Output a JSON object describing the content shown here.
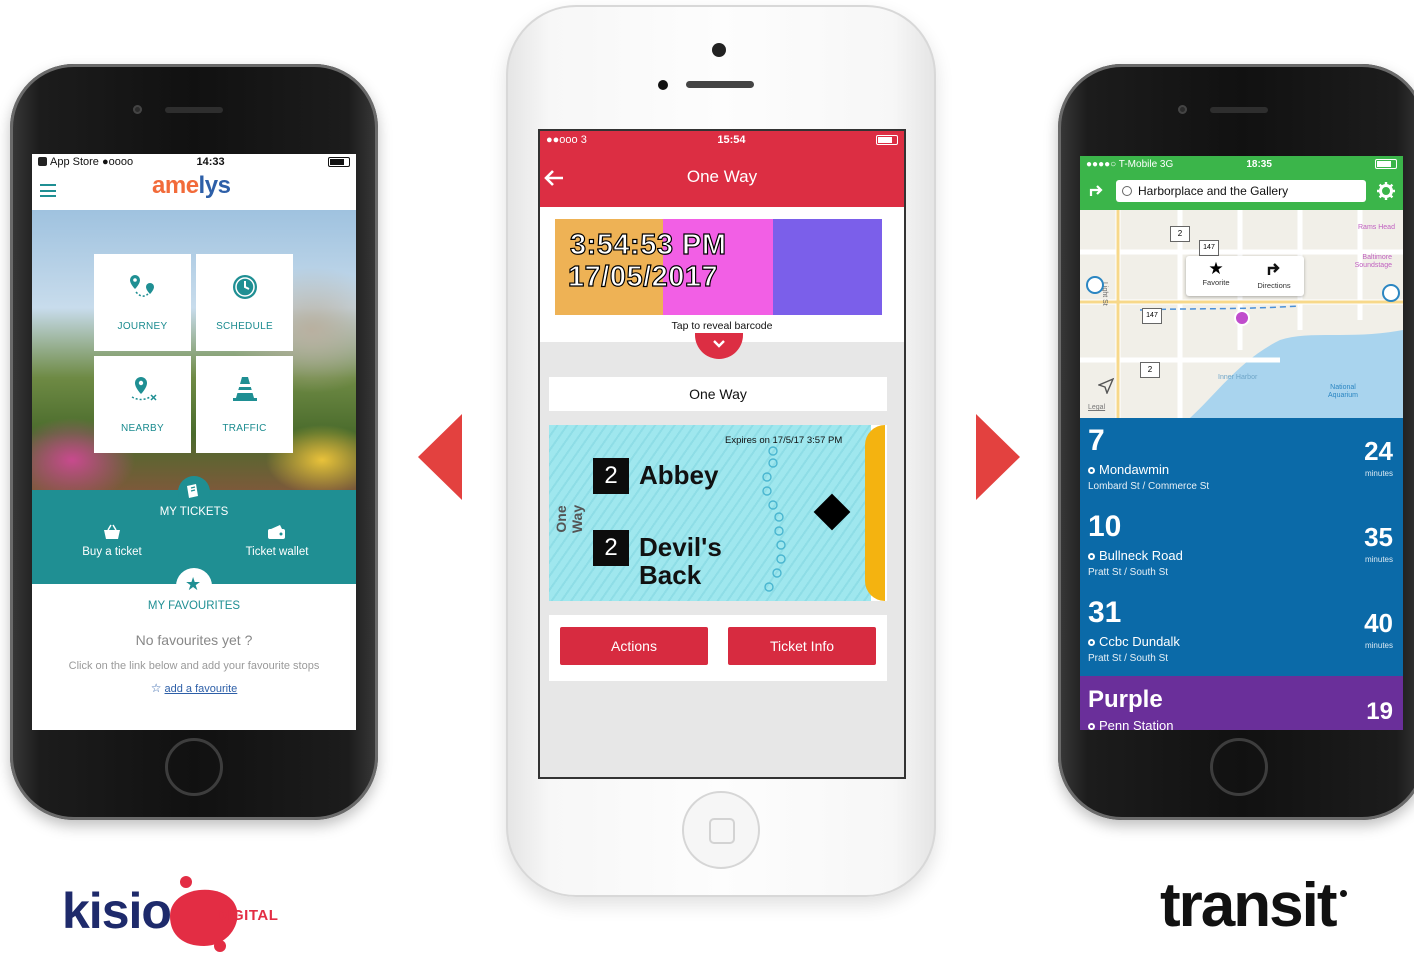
{
  "phone_amelys": {
    "status": {
      "carrier": "App Store",
      "signal": "●oooo",
      "time": "14:33"
    },
    "logo": {
      "pre": "ame",
      "accent": "l",
      "post": "ys"
    },
    "tiles": [
      {
        "label": "JOURNEY",
        "icon": "journey-icon"
      },
      {
        "label": "SCHEDULE",
        "icon": "clock-icon"
      },
      {
        "label": "NEARBY",
        "icon": "nearby-pin-icon"
      },
      {
        "label": "TRAFFIC",
        "icon": "traffic-cone-icon"
      }
    ],
    "my_tickets": {
      "title": "MY TICKETS",
      "buy": "Buy a ticket",
      "wallet": "Ticket wallet"
    },
    "favourites": {
      "title": "MY FAVOURITES",
      "empty": "No favourites yet ?",
      "hint": "Click on the link below and add your favourite stops",
      "link": "add a favourite"
    },
    "colors": {
      "teal": "#1f8f93",
      "brand_orange": "#f26b3a",
      "brand_blue": "#2d5fa8"
    }
  },
  "phone_ticket": {
    "status": {
      "signal": "●●ooo 3",
      "time": "15:54"
    },
    "header_title": "One Way",
    "banner": {
      "time": "3:54:53 PM",
      "date": "17/05/2017",
      "hint": "Tap to reveal barcode"
    },
    "ticket_type": "One Way",
    "ticket": {
      "side_label": "One Way",
      "expires": "Expires on 17/5/17 3:57 PM",
      "from": {
        "zone": "2",
        "name_l1": "Abbey",
        "name_l2": ""
      },
      "to": {
        "zone": "2",
        "name_l1": "Devil's",
        "name_l2": "Back"
      }
    },
    "buttons": {
      "actions": "Actions",
      "info": "Ticket Info"
    },
    "colors": {
      "red": "#dc2e43",
      "band_orange": "#eeb255",
      "band_pink": "#f25fe5",
      "band_purple": "#7b5fea"
    }
  },
  "phone_transit": {
    "status": {
      "carrier": "●●●●○ T-Mobile  3G",
      "time": "18:35"
    },
    "search": {
      "value": "Harborplace and the Gallery"
    },
    "map": {
      "labels": {
        "rams_head": "Rams Head",
        "baltimore_soundstage": "Baltimore Soundstage",
        "inner_harbor": "Inner Harbor",
        "national_aquarium": "National Aquarium",
        "light_st": "Light St",
        "legal": "Legal"
      },
      "route_shields": [
        "2",
        "147",
        "147",
        "2"
      ],
      "popup": {
        "favorite": "Favorite",
        "directions": "Directions"
      }
    },
    "routes": [
      {
        "number": "7",
        "destination": "Mondawmin",
        "stop": "Lombard St / Commerce St",
        "minutes": "24",
        "unit": "minutes",
        "color": "#0b6aa8"
      },
      {
        "number": "10",
        "destination": "Bullneck Road",
        "stop": "Pratt St / South St",
        "minutes": "35",
        "unit": "minutes",
        "color": "#0b6aa8"
      },
      {
        "number": "31",
        "destination": "Ccbc Dundalk",
        "stop": "Pratt St / South St",
        "minutes": "40",
        "unit": "minutes",
        "color": "#0b6aa8"
      },
      {
        "number": "Purple",
        "destination": "Penn Station",
        "stop": "",
        "minutes": "19",
        "unit": "",
        "color": "#6a2f9a"
      }
    ],
    "colors": {
      "green": "#3bb54a"
    }
  },
  "arrows": {
    "color": "#e3413f"
  },
  "logos": {
    "kisio": {
      "word": "kisio",
      "sub": "DIGITAL",
      "navy": "#1e2a6b",
      "red": "#e32d44"
    },
    "transit": {
      "word": "transit"
    }
  }
}
